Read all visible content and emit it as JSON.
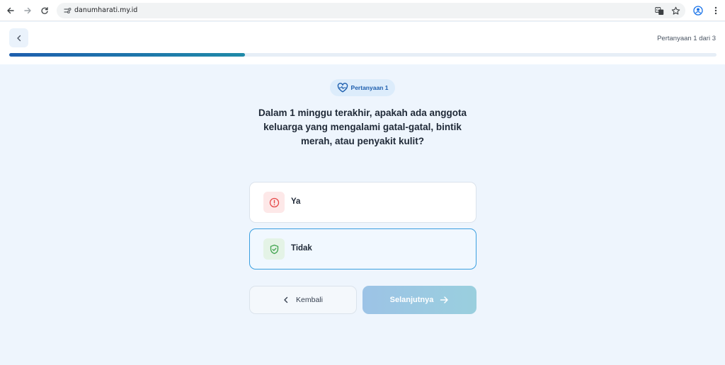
{
  "browser": {
    "url": "danumharati.my.id"
  },
  "header": {
    "counter": "Pertanyaan 1 dari 3",
    "progress_fraction": 0.333
  },
  "question": {
    "badge": "Pertanyaan 1",
    "text": "Dalam 1 minggu terakhir, apakah ada anggota keluarga yang mengalami gatal-gatal, bintik merah, atau penyakit kulit?"
  },
  "options": [
    {
      "label": "Ya",
      "icon": "alert-circle-icon",
      "selected": false,
      "color": "#e54848"
    },
    {
      "label": "Tidak",
      "icon": "shield-check-icon",
      "selected": true,
      "color": "#3fa34d"
    }
  ],
  "actions": {
    "back_label": "Kembali",
    "next_label": "Selanjutnya"
  },
  "colors": {
    "accent": "#1e5fae",
    "selected_border": "#3b9fe0",
    "background": "#eef5fd"
  }
}
